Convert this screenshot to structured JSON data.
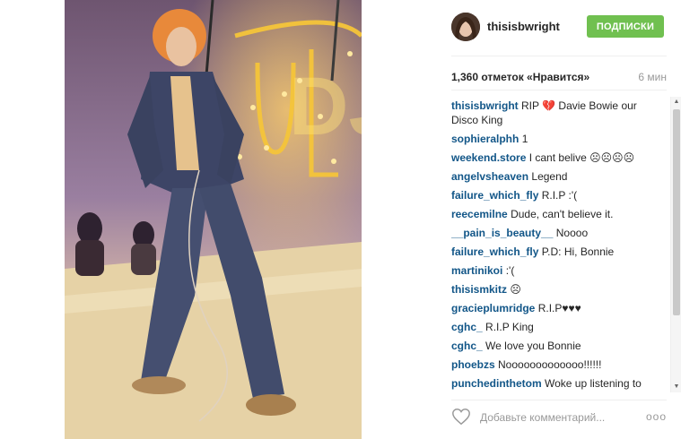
{
  "post": {
    "username": "thisisbwright",
    "follow_label": "ПОДПИСКИ",
    "likes": "1,360 отметок «Нравится»",
    "time": "6 мин",
    "photo_sign": "DJ",
    "comment_placeholder": "Добавьте комментарий...",
    "more_label": "ооо"
  },
  "icons": {
    "heart": "heart-outline-icon",
    "broken_heart": "broken-heart-icon",
    "more": "more-options-icon"
  },
  "comments": [
    {
      "user": "thisisbwright",
      "text": "RIP 💔 Davie Bowie our Disco King"
    },
    {
      "user": "sophieralphh",
      "text": "1"
    },
    {
      "user": "weekend.store",
      "text": "I cant belive ☹☹☹☹"
    },
    {
      "user": "angelvsheaven",
      "text": "Legend"
    },
    {
      "user": "failure_which_fly",
      "text": "R.I.P :'("
    },
    {
      "user": "reecemilne",
      "text": "Dude, can't believe it."
    },
    {
      "user": "__pain_is_beauty__",
      "text": "Noooo"
    },
    {
      "user": "failure_which_fly",
      "text": "P.D: Hi, Bonnie"
    },
    {
      "user": "martinikoi",
      "text": ":'("
    },
    {
      "user": "thisismkitz",
      "text": "☹"
    },
    {
      "user": "gracieplumridge",
      "text": "R.I.P♥♥♥"
    },
    {
      "user": "cghc_",
      "text": "R.I.P King"
    },
    {
      "user": "cghc_",
      "text": "We love you Bonnie"
    },
    {
      "user": "phoebzs",
      "text": "Nooooooooooooo!!!!!!"
    },
    {
      "user": "punchedinthetom",
      "text": "Woke up listening to Heroes thinking its gonna be a great day"
    }
  ],
  "colors": {
    "follow_button": "#70c050",
    "username_link": "#125688",
    "muted": "#999999"
  }
}
